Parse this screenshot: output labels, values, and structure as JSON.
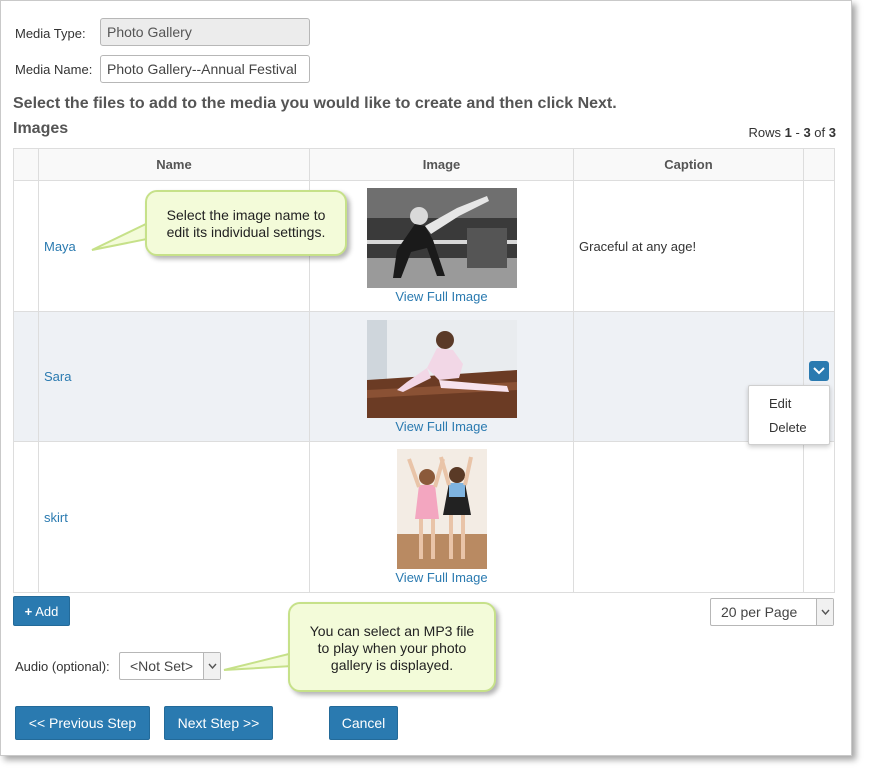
{
  "form": {
    "media_type_label": "Media Type:",
    "media_type_value": "Photo Gallery",
    "media_name_label": "Media Name:",
    "media_name_value": "Photo Gallery--Annual Festival"
  },
  "instructions": "Select the files to add to the media you would like to create and then click Next.",
  "section_title": "Images",
  "rows_info": {
    "prefix": "Rows ",
    "start": "1",
    "sep": " - ",
    "end": "3",
    "of": " of ",
    "total": "3"
  },
  "table": {
    "columns": [
      "Name",
      "Image",
      "Caption"
    ],
    "rows": [
      {
        "name": "Maya",
        "view_link": "View Full Image",
        "caption": "Graceful at any age!"
      },
      {
        "name": "Sara",
        "view_link": "View Full Image",
        "caption": ""
      },
      {
        "name": "skirt",
        "view_link": "View Full Image",
        "caption": ""
      }
    ]
  },
  "row_menu": {
    "items": [
      "Edit",
      "Delete"
    ]
  },
  "add_button": "Add",
  "page_size": "20 per Page",
  "audio": {
    "label": "Audio (optional):",
    "value": "<Not Set>"
  },
  "buttons": {
    "previous": "<< Previous Step",
    "next": "Next Step >>",
    "cancel": "Cancel"
  },
  "callouts": {
    "image_name": "Select the image name to edit its individual settings.",
    "audio": "You can select an MP3 file to play when your photo gallery is displayed."
  },
  "colors": {
    "accent": "#2a7ab0",
    "callout_bg": "#f3fbd9",
    "callout_border": "#c6e189"
  }
}
